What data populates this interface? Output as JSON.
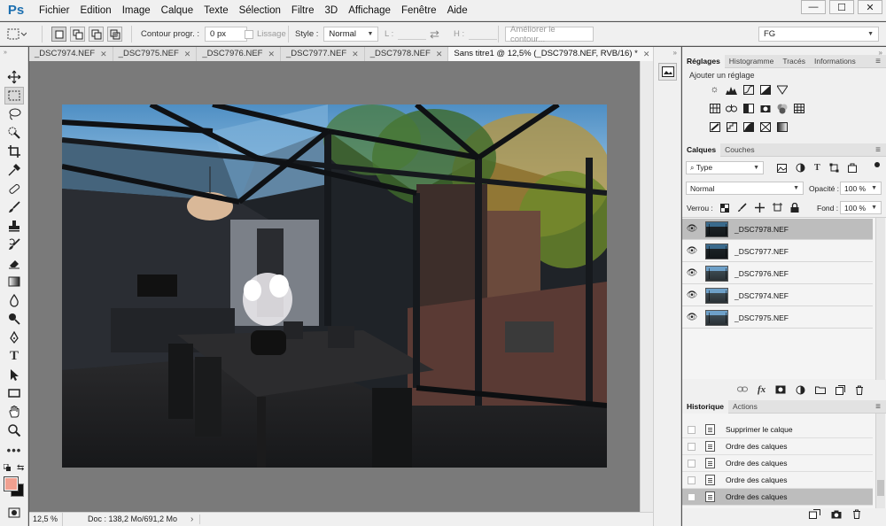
{
  "app": {
    "logo": "Ps"
  },
  "menu": [
    "Fichier",
    "Edition",
    "Image",
    "Calque",
    "Texte",
    "Sélection",
    "Filtre",
    "3D",
    "Affichage",
    "Fenêtre",
    "Aide"
  ],
  "window_controls": {
    "minimize": "—",
    "maximize": "☐",
    "close": "✕"
  },
  "options": {
    "contour_label": "Contour progr. :",
    "contour_value": "0 px",
    "lissage_label": "Lissage",
    "style_label": "Style :",
    "style_value": "Normal",
    "width_label": "L :",
    "height_label": "H :",
    "refine_button": "Améliorer le contour...",
    "workspace": "FG"
  },
  "tabs": [
    {
      "label": "_DSC7974.NEF",
      "active": false
    },
    {
      "label": "_DSC7975.NEF",
      "active": false
    },
    {
      "label": "_DSC7976.NEF",
      "active": false
    },
    {
      "label": "_DSC7977.NEF",
      "active": false
    },
    {
      "label": "_DSC7978.NEF",
      "active": false
    },
    {
      "label": "Sans titre1 @ 12,5% (_DSC7978.NEF, RVB/16) *",
      "active": true
    }
  ],
  "tabs_overflow": "»",
  "status": {
    "zoom": "12,5 %",
    "doc": "Doc : 138,2 Mo/691,2 Mo"
  },
  "colors": {
    "foreground": "#f0a090",
    "background": "#111111"
  },
  "panels": {
    "top_tabs": [
      "Réglages",
      "Histogramme",
      "Tracés",
      "Informations"
    ],
    "adjust_title": "Ajouter un réglage",
    "layer_tabs": [
      "Calques",
      "Couches"
    ],
    "kind_filter": "Type",
    "blend_mode": "Normal",
    "opacity_label": "Opacité :",
    "opacity_value": "100 %",
    "lock_label": "Verrou :",
    "fill_label": "Fond :",
    "fill_value": "100 %",
    "layers": [
      {
        "name": "_DSC7978.NEF",
        "selected": true,
        "dark": true
      },
      {
        "name": "_DSC7977.NEF",
        "selected": false,
        "dark": true
      },
      {
        "name": "_DSC7976.NEF",
        "selected": false,
        "dark": false
      },
      {
        "name": "_DSC7974.NEF",
        "selected": false,
        "dark": false
      },
      {
        "name": "_DSC7975.NEF",
        "selected": false,
        "dark": false
      }
    ],
    "history_tabs": [
      "Historique",
      "Actions"
    ],
    "history": [
      {
        "label": "Supprimer le calque",
        "selected": false
      },
      {
        "label": "Ordre des calques",
        "selected": false
      },
      {
        "label": "Ordre des calques",
        "selected": false
      },
      {
        "label": "Ordre des calques",
        "selected": false
      },
      {
        "label": "Ordre des calques",
        "selected": true
      }
    ]
  }
}
